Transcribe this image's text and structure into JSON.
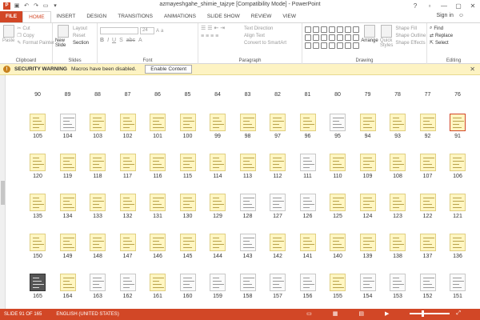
{
  "window": {
    "title": "azmayeshgahe_shimie_tajzye [Compatibility Mode] - PowerPoint",
    "app_icon": "P",
    "sign_in": "Sign in",
    "controls": [
      "?",
      "▫",
      "—",
      "▢",
      "✕"
    ]
  },
  "tabs": [
    "FILE",
    "HOME",
    "INSERT",
    "DESIGN",
    "TRANSITIONS",
    "ANIMATIONS",
    "SLIDE SHOW",
    "REVIEW",
    "VIEW"
  ],
  "ribbon": {
    "clipboard": {
      "label": "Clipboard",
      "paste": "Paste",
      "cut": "Cut",
      "copy": "Copy",
      "format_painter": "Format Painter"
    },
    "slides": {
      "label": "Slides",
      "new_slide": "New Slide",
      "layout": "Layout",
      "reset": "Reset",
      "section": "Section"
    },
    "font": {
      "label": "Font",
      "size": "24"
    },
    "paragraph": {
      "label": "Paragraph",
      "text_direction": "Text Direction",
      "align_text": "Align Text",
      "convert": "Convert to SmartArt"
    },
    "drawing": {
      "label": "Drawing",
      "arrange": "Arrange",
      "quick_styles": "Quick Styles",
      "shape_fill": "Shape Fill",
      "shape_outline": "Shape Outline",
      "shape_effects": "Shape Effects"
    },
    "editing": {
      "label": "Editing",
      "find": "Find",
      "replace": "Replace",
      "select": "Select"
    }
  },
  "security": {
    "title": "SECURITY WARNING",
    "message": "Macros have been disabled.",
    "button": "Enable Content"
  },
  "slides": {
    "selected": 91,
    "rows": [
      [
        90,
        89,
        88,
        87,
        86,
        85,
        84,
        83,
        82,
        81,
        80,
        79,
        78,
        77,
        76
      ],
      [
        105,
        104,
        103,
        102,
        101,
        100,
        99,
        98,
        97,
        96,
        95,
        94,
        93,
        92,
        91
      ],
      [
        120,
        119,
        118,
        117,
        116,
        115,
        114,
        113,
        112,
        111,
        110,
        109,
        108,
        107,
        106
      ],
      [
        135,
        134,
        133,
        132,
        131,
        130,
        129,
        128,
        127,
        126,
        125,
        124,
        123,
        122,
        121
      ],
      [
        150,
        149,
        148,
        147,
        146,
        145,
        144,
        143,
        142,
        141,
        140,
        139,
        138,
        137,
        136
      ],
      [
        165,
        164,
        163,
        162,
        161,
        160,
        159,
        158,
        157,
        156,
        155,
        154,
        153,
        152,
        151
      ]
    ],
    "white": [
      104,
      111,
      95,
      128,
      127,
      126,
      143,
      163,
      162,
      160,
      159,
      158,
      157,
      156,
      154,
      153,
      152,
      151
    ],
    "dark": [
      165
    ]
  },
  "status": {
    "slide_info": "SLIDE 91 OF 165",
    "language": "ENGLISH (UNITED STATES)"
  }
}
